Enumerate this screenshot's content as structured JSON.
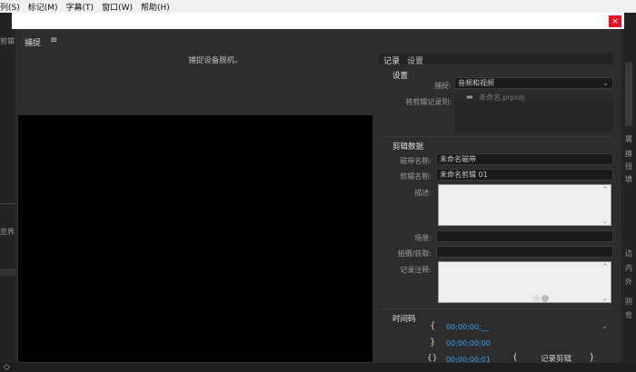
{
  "menubar": {
    "items": [
      "列(S)",
      "标记(M)",
      "字幕(T)",
      "窗口(W)",
      "帮助(H)"
    ]
  },
  "background": {
    "left_texts": [
      "剪辑",
      "览界\u0002",
      "源"
    ],
    "right_texts": [
      "属",
      "换",
      "扭",
      "填",
      "边",
      "内",
      "外",
      "阴",
      "背"
    ]
  },
  "dialog": {
    "close_label": "×",
    "panel_title": "捕捉",
    "menu_icon": "≡",
    "status_text": "捕捉设备脱机。",
    "tabs": [
      "记录",
      "设置"
    ],
    "settings": {
      "title": "设置",
      "capture_label": "捕捉:",
      "capture_value": "音频和视频",
      "record_clip_label": "将剪辑记录到:",
      "project_name": "未命名.prproj"
    },
    "clip_data": {
      "title": "剪辑数据",
      "tape_name_label": "磁带名称:",
      "tape_name_value": "未命名磁带",
      "clip_name_label": "剪辑名称:",
      "clip_name_value": "未命名剪辑 01",
      "description_label": "描述:",
      "scene_label": "场景:",
      "shot_label": "拍摄/获取:",
      "log_note_label": "记录注释:"
    },
    "timecode": {
      "title": "时间码",
      "in_value": "00;00;00;__",
      "out_value": "00;00;00;00",
      "duration_value": "00;00;00;01",
      "log_clip_label": "记录剪辑"
    }
  },
  "colors": {
    "timecode": "#3ba2f0",
    "close": "#e81123",
    "preview": "#000000"
  }
}
